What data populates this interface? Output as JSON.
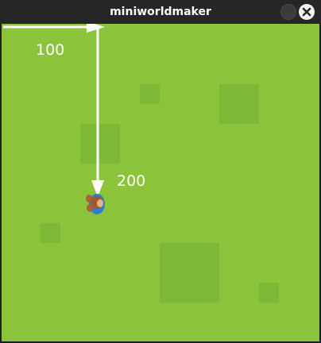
{
  "window": {
    "title": "miniworldmaker"
  },
  "world": {
    "background_color": "#8bc43a",
    "patch_color": "#7db836",
    "labels": {
      "x_distance": "100",
      "y_distance": "200"
    },
    "actor": {
      "icon": "player-topdown-icon"
    }
  }
}
